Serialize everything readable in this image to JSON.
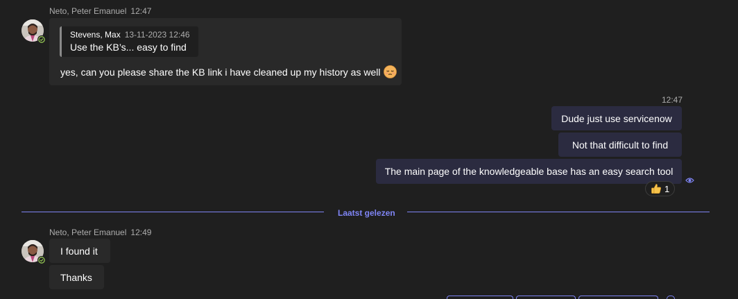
{
  "messages": [
    {
      "sender": "Neto, Peter Emanuel",
      "time": "12:47",
      "quote": {
        "author": "Stevens, Max",
        "timestamp": "13-11-2023 12:46",
        "text": "Use the KB’s... easy to find"
      },
      "text": "yes, can you please share the KB link i have cleaned up my history as well",
      "emoji": "pensive-face-emoji"
    },
    {
      "time": "12:47",
      "outgoing": [
        "Dude just use servicenow",
        "Not that difficult to find",
        "The main page of the knowledgeable base has an easy search tool"
      ],
      "reaction": {
        "emoji": "thumbs-up-emoji",
        "count": "1"
      },
      "read_receipt": "seen-eye-icon"
    }
  ],
  "divider": {
    "label": "Laatst gelezen"
  },
  "second_group": {
    "sender": "Neto, Peter Emanuel",
    "time": "12:49",
    "messages": [
      "I found it",
      "Thanks"
    ]
  },
  "colors": {
    "background": "#1f1f1f",
    "incoming_bubble": "#292929",
    "outgoing_bubble": "#2b2b40",
    "accent": "#7f85f5",
    "presence": "#92c353"
  }
}
